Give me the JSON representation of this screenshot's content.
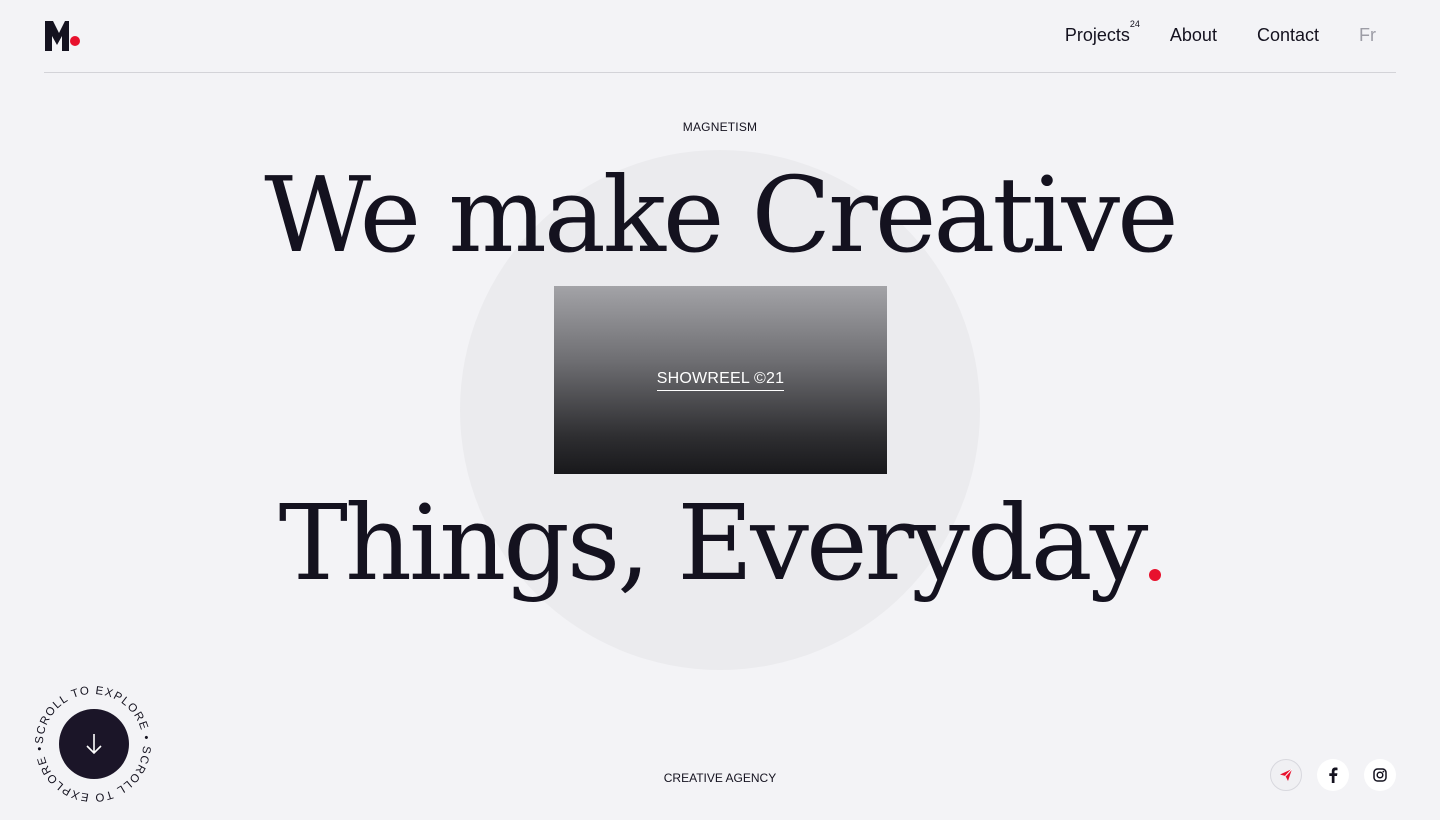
{
  "brand": {
    "logo_icon": "magnetism-logo-icon",
    "accent": "#e8112d",
    "dark": "#14121f"
  },
  "nav": {
    "projects_label": "Projects",
    "projects_count": "24",
    "about_label": "About",
    "contact_label": "Contact",
    "lang_label": "Fr"
  },
  "hero": {
    "eyebrow": "MAGNETISM",
    "line1": "We make Creative",
    "line2": "Things, Everyday",
    "showreel_label": "SHOWREEL ©21"
  },
  "scroll": {
    "text": "SCROLL TO EXPLORE • SCROLL TO EXPLORE •",
    "icon": "arrow-down-icon"
  },
  "footer": {
    "label": "CREATIVE AGENCY",
    "socials": [
      "telegram-icon",
      "facebook-icon",
      "instagram-icon"
    ]
  }
}
